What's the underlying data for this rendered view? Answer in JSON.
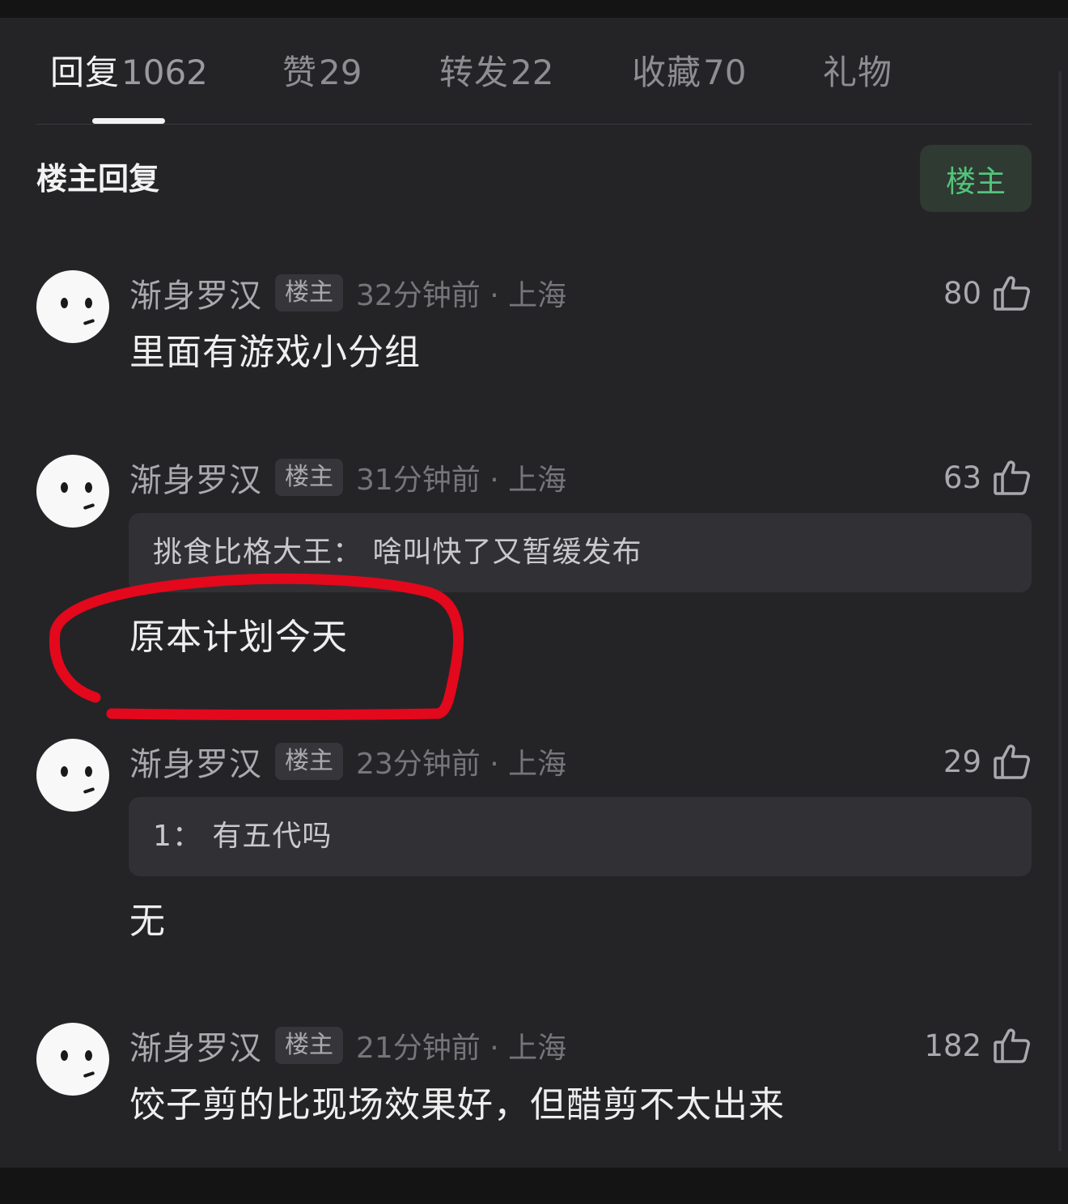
{
  "tabs": [
    {
      "label": "回复",
      "count": "1062"
    },
    {
      "label": "赞",
      "count": "29"
    },
    {
      "label": "转发",
      "count": "22"
    },
    {
      "label": "收藏",
      "count": "70"
    },
    {
      "label": "礼物",
      "count": ""
    }
  ],
  "section": {
    "title": "楼主回复",
    "filter_button": "楼主"
  },
  "comments": [
    {
      "user": "渐身罗汉",
      "badge": "楼主",
      "time": "32分钟前 · 上海",
      "likes": "80",
      "text": "里面有游戏小分组"
    },
    {
      "user": "渐身罗汉",
      "badge": "楼主",
      "time": "31分钟前 · 上海",
      "likes": "63",
      "quote": "挑食比格大王： 啥叫快了又暂缓发布",
      "text": "原本计划今天"
    },
    {
      "user": "渐身罗汉",
      "badge": "楼主",
      "time": "23分钟前 · 上海",
      "likes": "29",
      "quote": "1： 有五代吗",
      "text": "无"
    },
    {
      "user": "渐身罗汉",
      "badge": "楼主",
      "time": "21分钟前 · 上海",
      "likes": "182",
      "text": "饺子剪的比现场效果好，但醋剪不太出来"
    }
  ],
  "colors": {
    "accent_green": "#53c47a",
    "annotation_red": "#e3081c",
    "background": "#242427"
  },
  "icons": {
    "like": "thumbs-up-icon"
  }
}
